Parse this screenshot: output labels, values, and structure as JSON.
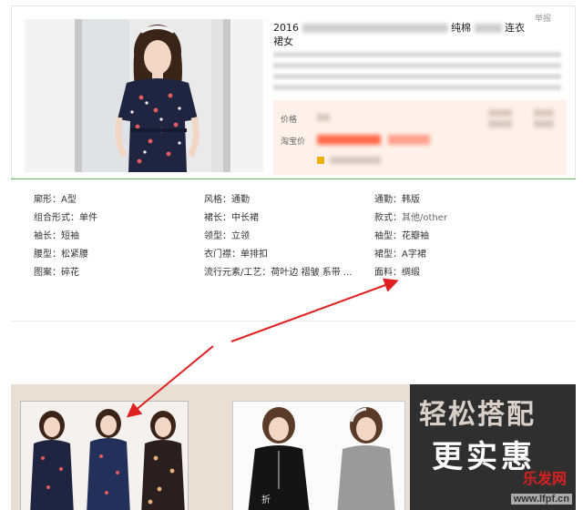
{
  "product": {
    "report_label": "举报",
    "title_line1_prefix": "2016",
    "title_line1_mid": "纯棉",
    "title_line1_suffix": "连衣",
    "title_line2": "裙女",
    "price_label": "价格",
    "taobao_price_label": "淘宝价"
  },
  "attributes": [
    [
      {
        "label": "廓形",
        "value": "A型"
      },
      {
        "label": "风格",
        "value": "通勤"
      },
      {
        "label": "通勤",
        "value": "韩版"
      }
    ],
    [
      {
        "label": "组合形式",
        "value": "单件"
      },
      {
        "label": "裙长",
        "value": "中长裙"
      },
      {
        "label": "款式",
        "value": "其他/other"
      }
    ],
    [
      {
        "label": "袖长",
        "value": "短袖"
      },
      {
        "label": "领型",
        "value": "立领"
      },
      {
        "label": "袖型",
        "value": "花瓣袖"
      }
    ],
    [
      {
        "label": "腰型",
        "value": "松紧腰"
      },
      {
        "label": "衣门襟",
        "value": "单排扣"
      },
      {
        "label": "裙型",
        "value": "A字裙"
      }
    ],
    [
      {
        "label": "图案",
        "value": "碎花"
      },
      {
        "label": "流行元素/工艺",
        "value": "荷叶边 褶皱 系带 ..."
      },
      {
        "label": "面料",
        "value": "绸缎"
      }
    ]
  ],
  "banner": {
    "promo_line1": "轻松搭配",
    "promo_line2": "更实惠",
    "thumb_tag": "折",
    "watermark_brand": "乐发网",
    "watermark_url": "www.lfpf.cn"
  },
  "colors": {
    "accent_green": "#5fb75f",
    "arrow_red": "#e02020",
    "price_bg": "#fdf1ea"
  }
}
